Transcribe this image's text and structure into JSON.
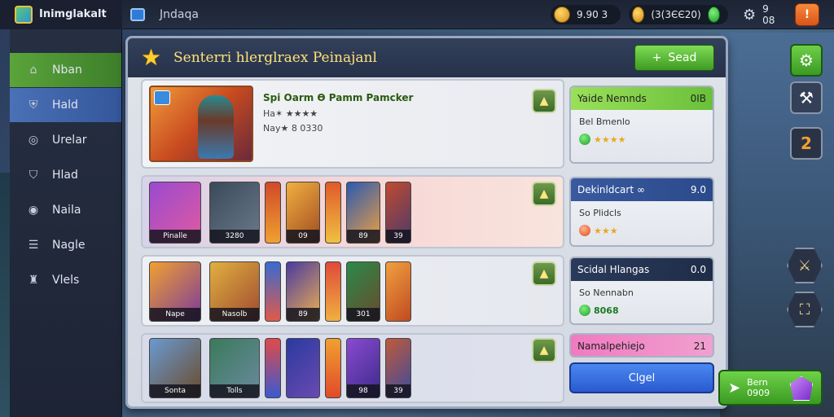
{
  "app": {
    "title": "Inimglakalt",
    "tab_label": "Jndaqa"
  },
  "topbar": {
    "currency1": "9.90 3",
    "currency2": "(3(3ЄЄ20)",
    "currency3": "9 08",
    "orange_badge": "!",
    "icons": [
      "gold-coin-icon",
      "gold-coin-icon",
      "green-gem-icon",
      "gear-icon"
    ]
  },
  "sidebar": {
    "items": [
      {
        "label": "Nban",
        "icon": "home-icon"
      },
      {
        "label": "Hald",
        "icon": "shield-icon"
      },
      {
        "label": "Urelar",
        "icon": "shield-check-icon"
      },
      {
        "label": "Hlad",
        "icon": "shield-check-icon"
      },
      {
        "label": "Naila",
        "icon": "shield-check-icon"
      },
      {
        "label": "Nagle",
        "icon": "list-icon"
      },
      {
        "label": "Vlels",
        "icon": "castle-icon"
      }
    ]
  },
  "panel": {
    "title": "Senterri hlerglraex Peinajanl",
    "seed_button": "Sead"
  },
  "hero": {
    "name": "Spi Oarm Ɵ Pamm Pamcker",
    "line1": "Ha✶ ★★★★",
    "line2": "Nay★ 8 0330"
  },
  "row2_cards": [
    {
      "label": "Pinalle"
    },
    {
      "label": "3280"
    },
    {
      "label": ""
    },
    {
      "label": "09"
    },
    {
      "label": ""
    },
    {
      "label": "89"
    },
    {
      "label": "39"
    }
  ],
  "row3_cards": [
    {
      "label": "Nape"
    },
    {
      "label": "Nasolb"
    },
    {
      "label": ""
    },
    {
      "label": "89"
    },
    {
      "label": ""
    },
    {
      "label": "301"
    },
    {
      "label": ""
    }
  ],
  "row4_cards": [
    {
      "label": "Sonta"
    },
    {
      "label": "Tolls"
    },
    {
      "label": ""
    },
    {
      "label": ""
    },
    {
      "label": ""
    },
    {
      "label": "98"
    },
    {
      "label": "39"
    }
  ],
  "info_cards": [
    {
      "title": "Yaide Nemnds",
      "num": "0IB",
      "body1": "Bel Bmenlo",
      "body2": "★★★★"
    },
    {
      "title": "Dekinldcart ∞",
      "num": "9.0",
      "body1": "So Plidcls",
      "body2": "★★★"
    },
    {
      "title": "Scidal Hlangas",
      "num": "0.0",
      "body1": "So Nennabn",
      "body2": "8068"
    },
    {
      "title": "Namalpehiejo",
      "num": "21"
    }
  ],
  "blue_button": "Clgel",
  "bottom_right": {
    "line1": "Bern",
    "line2": "0909"
  }
}
